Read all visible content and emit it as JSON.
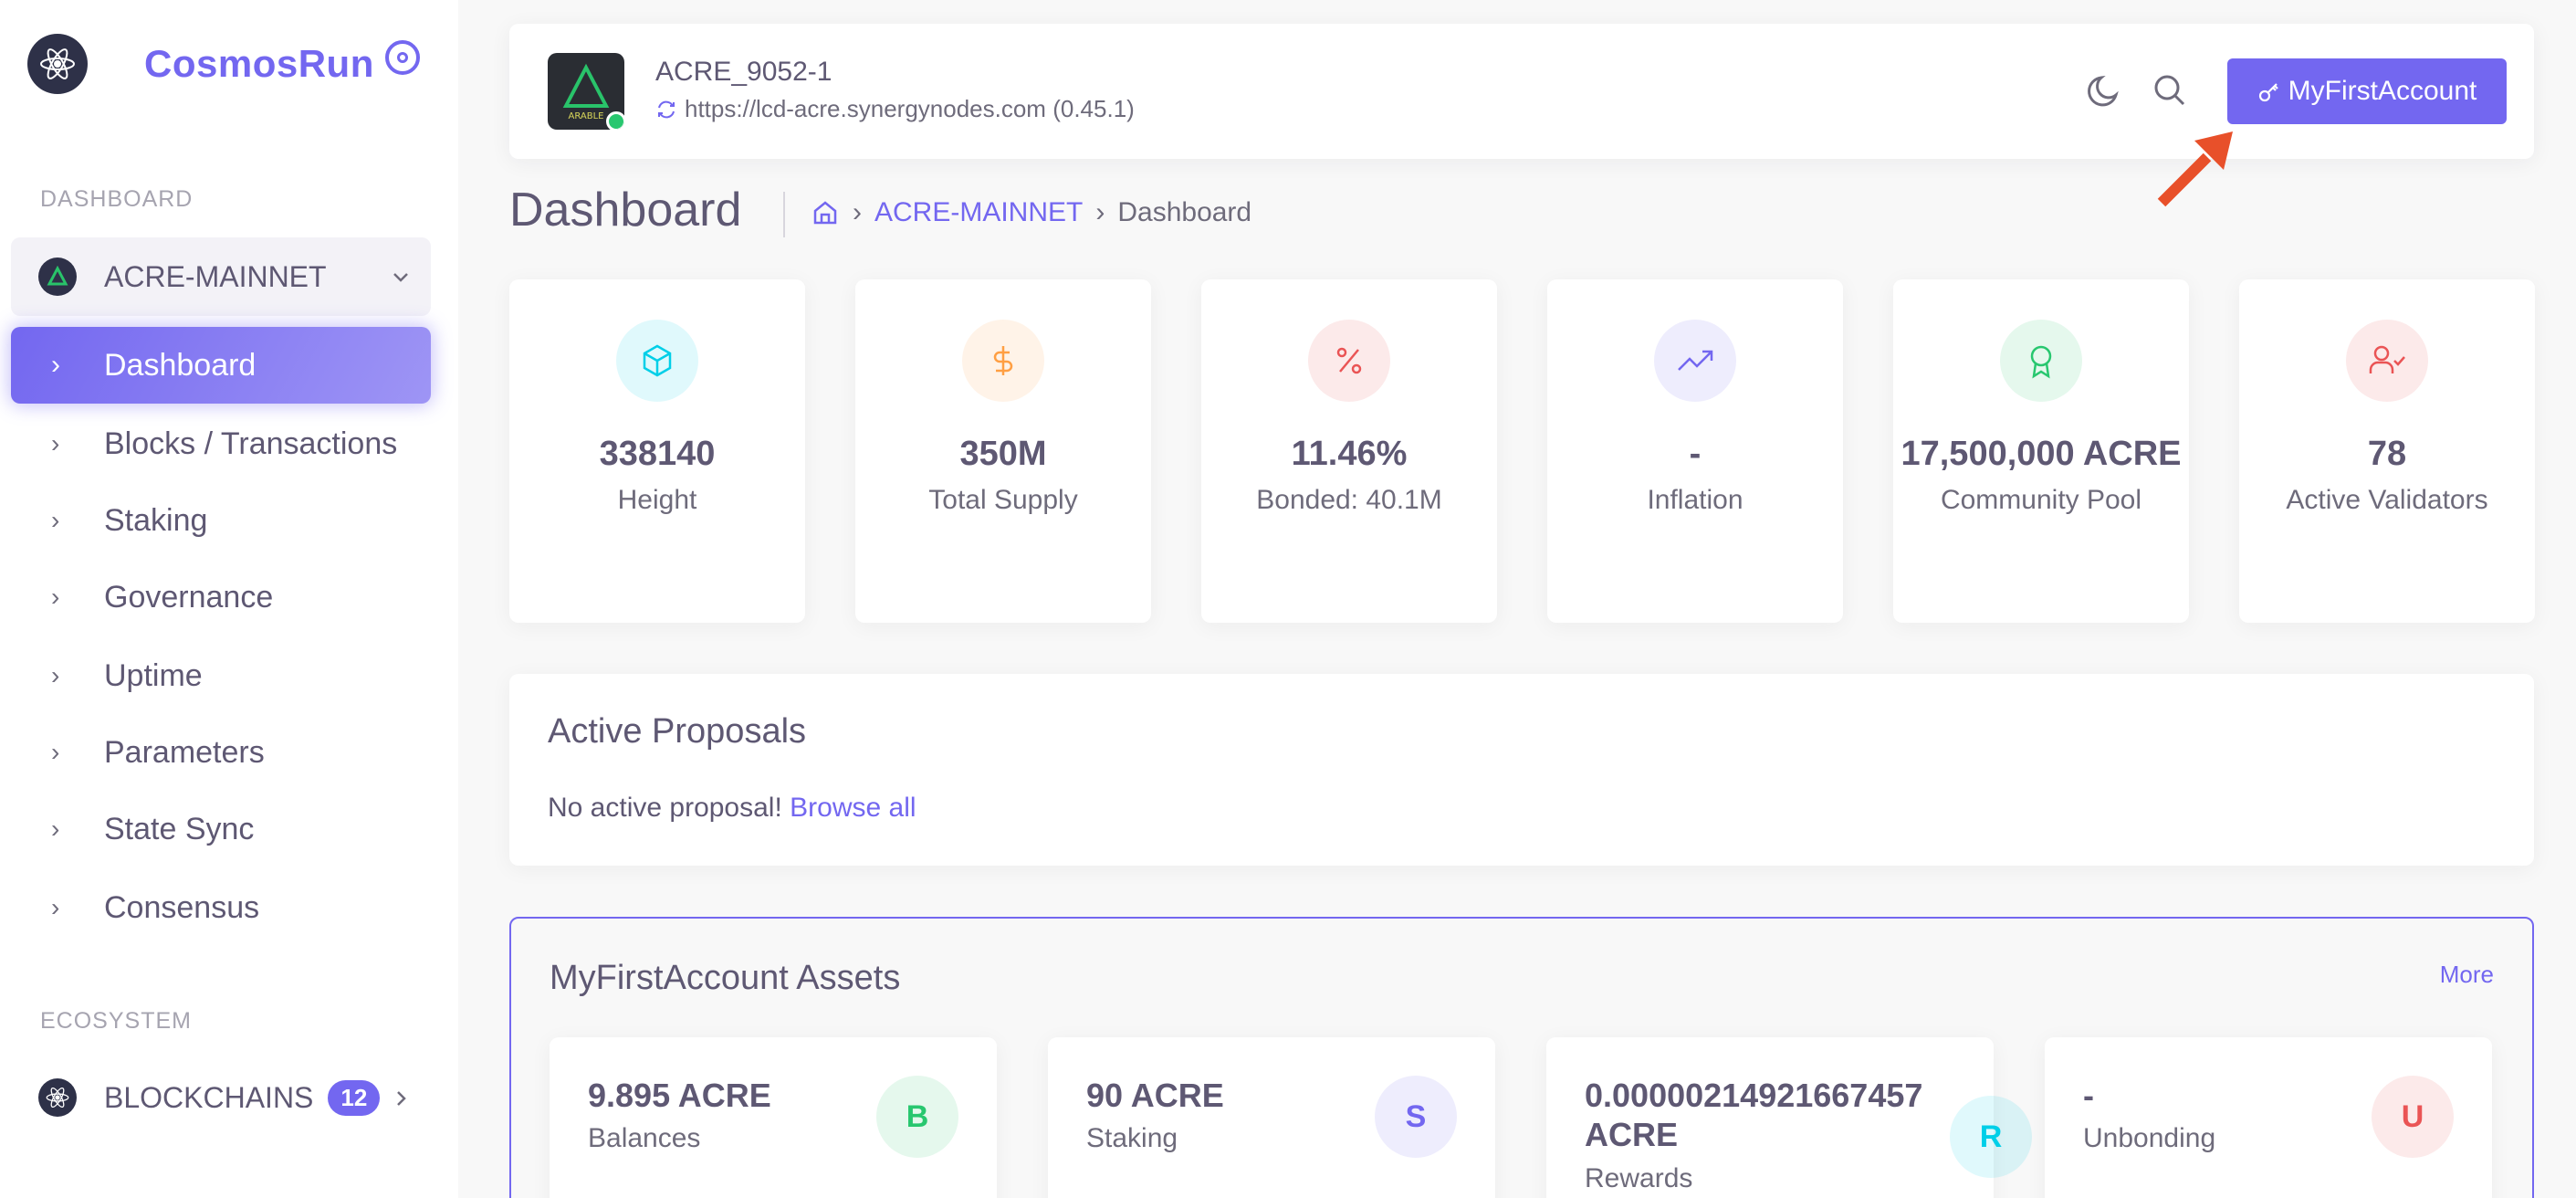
{
  "sidebar": {
    "brand": "CosmosRun",
    "dashboard_header": "DASHBOARD",
    "chain": "ACRE-MAINNET",
    "nav": [
      {
        "label": "Dashboard",
        "active": true
      },
      {
        "label": "Blocks / Transactions"
      },
      {
        "label": "Staking"
      },
      {
        "label": "Governance"
      },
      {
        "label": "Uptime"
      },
      {
        "label": "Parameters"
      },
      {
        "label": "State Sync"
      },
      {
        "label": "Consensus"
      }
    ],
    "ecosystem_header": "ECOSYSTEM",
    "blockchains_label": "BLOCKCHAINS",
    "blockchains_count": "12"
  },
  "header": {
    "chain_id": "ACRE_9052-1",
    "endpoint": "https://lcd-acre.synergynodes.com",
    "version": "(0.45.1)",
    "account_button": "MyFirstAccount"
  },
  "page": {
    "title": "Dashboard",
    "breadcrumb": {
      "chain": "ACRE-MAINNET",
      "current": "Dashboard"
    }
  },
  "stats": [
    {
      "value": "338140",
      "label": "Height",
      "icon": "box-icon",
      "color": "#00cfe8"
    },
    {
      "value": "350M",
      "label": "Total Supply",
      "icon": "dollar-icon",
      "color": "#ff9f43"
    },
    {
      "value": "11.46%",
      "label": "Bonded: 40.1M",
      "icon": "percent-icon",
      "color": "#ea5455"
    },
    {
      "value": "-",
      "label": "Inflation",
      "icon": "trending-up-icon",
      "color": "#7367f0"
    },
    {
      "value": "17,500,000 ACRE",
      "label": "Community Pool",
      "icon": "award-icon",
      "color": "#28c76f"
    },
    {
      "value": "78",
      "label": "Active Validators",
      "icon": "user-check-icon",
      "color": "#ea5455"
    }
  ],
  "proposals": {
    "title": "Active Proposals",
    "empty_text": "No active proposal!",
    "browse_link": "Browse all"
  },
  "assets": {
    "title": "MyFirstAccount Assets",
    "more": "More",
    "items": [
      {
        "value": "9.895 ACRE",
        "label": "Balances",
        "avatar": "B",
        "color": "#28c76f"
      },
      {
        "value": "90 ACRE",
        "label": "Staking",
        "avatar": "S",
        "color": "#7367f0"
      },
      {
        "value": "0.00000214921667457 ACRE",
        "label": "Rewards",
        "avatar": "R",
        "color": "#00cfe8"
      },
      {
        "value": "-",
        "label": "Unbonding",
        "avatar": "U",
        "color": "#ea5455"
      }
    ]
  },
  "colors": {
    "primary": "#7367f0",
    "text": "#5e5873",
    "muted": "#6e6b7b"
  }
}
